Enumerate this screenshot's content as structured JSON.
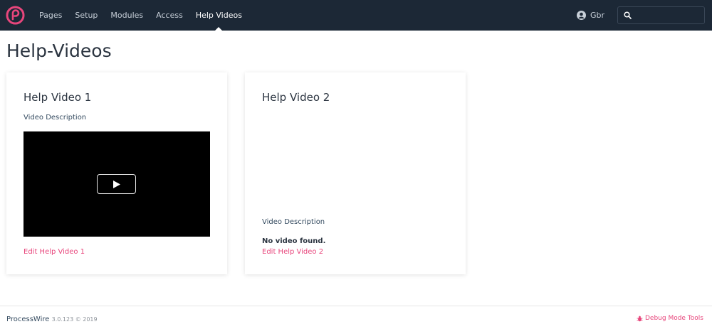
{
  "nav": {
    "items": [
      {
        "label": "Pages",
        "active": false
      },
      {
        "label": "Setup",
        "active": false
      },
      {
        "label": "Modules",
        "active": false
      },
      {
        "label": "Access",
        "active": false
      },
      {
        "label": "Help Videos",
        "active": true
      }
    ],
    "user_name": "Gbr",
    "search_placeholder": ""
  },
  "page": {
    "title": "Help-Videos"
  },
  "cards": [
    {
      "title": "Help Video 1",
      "description": "Video Description",
      "edit_link": "Edit Help Video 1"
    },
    {
      "title": "Help Video 2",
      "description": "Video Description",
      "no_video_text": "No video found.",
      "edit_link": "Edit Help Video 2"
    }
  ],
  "footer": {
    "brand": "ProcessWire",
    "version": "3.0.123 © 2019",
    "debug_link": "Debug Mode Tools"
  },
  "colors": {
    "topbar": "#1c2836",
    "accent": "#e8467c",
    "text": "#354b60"
  }
}
